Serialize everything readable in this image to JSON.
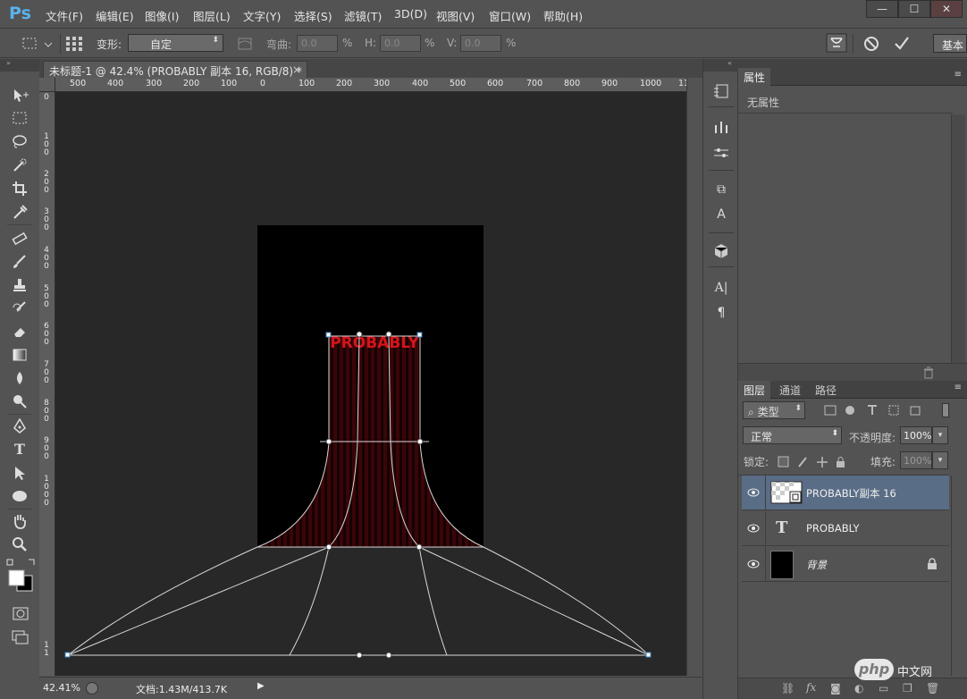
{
  "app": {
    "logo": "Ps"
  },
  "menu": [
    "文件(F)",
    "编辑(E)",
    "图像(I)",
    "图层(L)",
    "文字(Y)",
    "选择(S)",
    "滤镜(T)",
    "3D(D)",
    "视图(V)",
    "窗口(W)",
    "帮助(H)"
  ],
  "window_controls": {
    "minimize": "—",
    "maximize": "☐",
    "close": "✕"
  },
  "options": {
    "transform_label": "变形:",
    "transform_value": "自定",
    "bend_label": "弯曲:",
    "bend_value": "0.0",
    "h_label": "H:",
    "h_value": "0.0",
    "v_label": "V:",
    "v_value": "0.0",
    "percent": "%",
    "workspace": "基本"
  },
  "document": {
    "tab_title": "未标题-1 @ 42.4% (PROBABLY 副本 16, RGB/8) *",
    "tab_close": "×",
    "canvas_text": "PROBABLY",
    "ruler_top": [
      "500",
      "400",
      "300",
      "200",
      "100",
      "0",
      "100",
      "200",
      "300",
      "400",
      "500",
      "600",
      "700",
      "800",
      "900",
      "1000",
      "11"
    ],
    "ruler_left": [
      [
        "0"
      ],
      [
        "1",
        "0",
        "0"
      ],
      [
        "2",
        "0",
        "0"
      ],
      [
        "3",
        "0",
        "0"
      ],
      [
        "4",
        "0",
        "0"
      ],
      [
        "5",
        "0",
        "0"
      ],
      [
        "6",
        "0",
        "0"
      ],
      [
        "7",
        "0",
        "0"
      ],
      [
        "8",
        "0",
        "0"
      ],
      [
        "9",
        "0",
        "0"
      ],
      [
        "1",
        "0",
        "0",
        "0"
      ],
      [
        "1",
        "1"
      ]
    ],
    "zoom": "42.41%",
    "doc_info": "文档:1.43M/413.7K"
  },
  "properties": {
    "tab": "属性",
    "empty_text": "无属性"
  },
  "layers_panel": {
    "tabs": [
      "图层",
      "通道",
      "路径"
    ],
    "filter_label": "类型",
    "blend_mode": "正常",
    "opacity_label": "不透明度:",
    "opacity_value": "100%",
    "lock_label": "锁定:",
    "fill_label": "填充:",
    "fill_value": "100%",
    "layers": [
      {
        "name": "PROBABLY副本 16",
        "type": "smart-object",
        "selected": true
      },
      {
        "name": "PROBABLY",
        "type": "text",
        "selected": false
      },
      {
        "name": "背景",
        "type": "background",
        "selected": false,
        "locked": true
      }
    ]
  },
  "watermark": {
    "text": "php",
    "subtext": "中文网"
  },
  "colors": {
    "ui_bg": "#535353",
    "canvas_bg": "#282828",
    "text_red": "#d5141a",
    "selected_layer": "#5a6d86"
  }
}
